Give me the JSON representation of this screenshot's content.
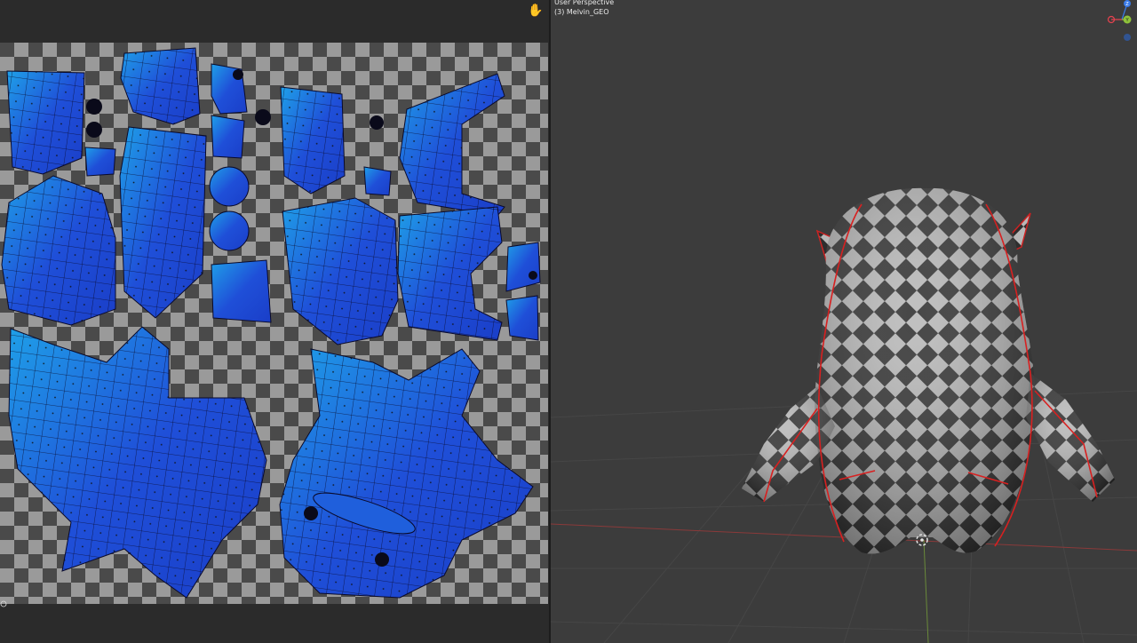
{
  "viewport": {
    "perspective_label": "User Perspective",
    "object_label": "(3) Melvin_GEO"
  },
  "gizmo": {
    "z_label": "Z",
    "y_label": "Y",
    "x_label": "X",
    "colors": {
      "x": "#e8424f",
      "y": "#8fc23a",
      "z": "#3a7be8"
    }
  },
  "uv_editor": {
    "pan_icon": "hand-pan-icon"
  },
  "colors": {
    "uv_island": "#1f4fd8",
    "uv_island_light": "#1fa0e8",
    "seam": "#e02020",
    "checker_light": "#9a9a9a",
    "checker_dark": "#4a4a4a"
  }
}
